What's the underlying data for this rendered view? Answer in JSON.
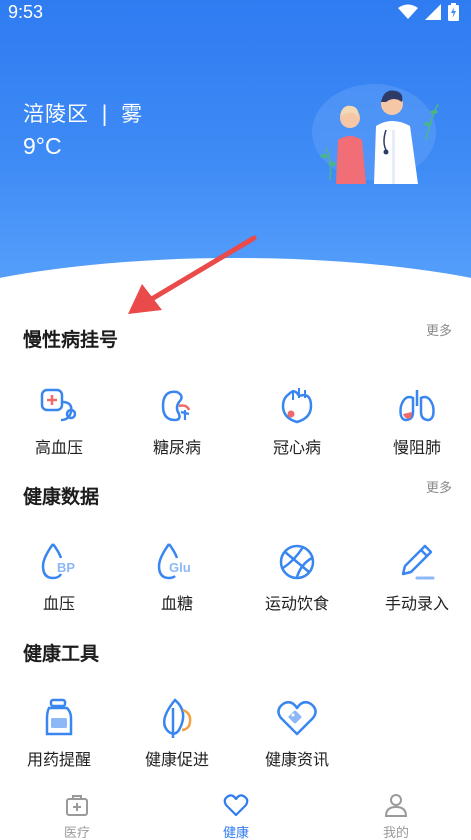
{
  "status_bar": {
    "time": "9:53"
  },
  "weather": {
    "district": "涪陵区",
    "separator": "|",
    "condition": "雾",
    "temperature": "9°C"
  },
  "sections": [
    {
      "title": "慢性病挂号",
      "more": "更多",
      "items": [
        {
          "label": "高血压",
          "icon": "blood-pressure-monitor-icon"
        },
        {
          "label": "糖尿病",
          "icon": "kidney-icon"
        },
        {
          "label": "冠心病",
          "icon": "heart-icon"
        },
        {
          "label": "慢阻肺",
          "icon": "lungs-icon"
        }
      ]
    },
    {
      "title": "健康数据",
      "more": "更多",
      "items": [
        {
          "label": "血压",
          "icon": "bp-drop-icon",
          "badge": "BP"
        },
        {
          "label": "血糖",
          "icon": "glucose-drop-icon",
          "badge": "Glu"
        },
        {
          "label": "运动饮食",
          "icon": "ball-icon"
        },
        {
          "label": "手动录入",
          "icon": "pencil-icon"
        }
      ]
    },
    {
      "title": "健康工具",
      "items": [
        {
          "label": "用药提醒",
          "icon": "medicine-bottle-icon"
        },
        {
          "label": "健康促进",
          "icon": "leaf-icon"
        },
        {
          "label": "健康资讯",
          "icon": "heart-tag-icon"
        }
      ]
    }
  ],
  "tabs": [
    {
      "label": "医疗",
      "icon": "medical-kit-icon",
      "active": false
    },
    {
      "label": "健康",
      "icon": "heart-outline-icon",
      "active": true
    },
    {
      "label": "我的",
      "icon": "person-icon",
      "active": false
    }
  ],
  "colors": {
    "accent": "#2f7bf1",
    "icon_blue": "#3a86f0",
    "icon_red": "#f06a6a",
    "icon_orange": "#f5a042",
    "tab_inactive": "#9a9a9a"
  }
}
